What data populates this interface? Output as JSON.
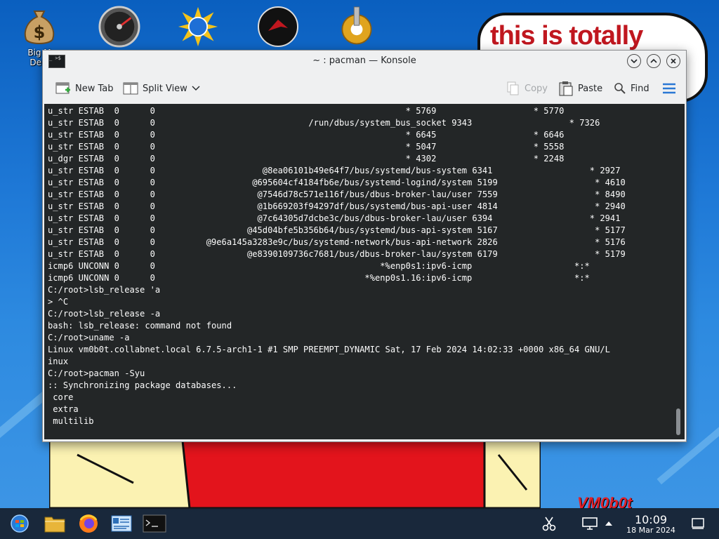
{
  "desktop": {
    "bubble_text": "this is totally",
    "signature": "VM0b0t",
    "icons": [
      {
        "name": "money-bag-icon",
        "label": "Big M"
      },
      {
        "name": "speedometer-icon",
        "label": ""
      },
      {
        "name": "sun-globe-icon",
        "label": ""
      },
      {
        "name": "red-disc-icon",
        "label": ""
      },
      {
        "name": "gear-icon",
        "label": ""
      }
    ],
    "icon0_label_line2": "Dele"
  },
  "window": {
    "title": "~ : pacman — Konsole",
    "icon_glyph": "_ >$",
    "buttons": [
      "minimize",
      "maximize",
      "close"
    ]
  },
  "toolbar": {
    "new_tab": "New Tab",
    "split_view": "Split View",
    "copy": "Copy",
    "paste": "Paste",
    "find": "Find"
  },
  "terminal": {
    "lines": [
      "u_str ESTAB  0      0                                                 * 5769                   * 5770",
      "u_str ESTAB  0      0                              /run/dbus/system_bus_socket 9343                   * 7326",
      "u_str ESTAB  0      0                                                 * 6645                   * 6646",
      "u_str ESTAB  0      0                                                 * 5047                   * 5558",
      "u_dgr ESTAB  0      0                                                 * 4302                   * 2248",
      "u_str ESTAB  0      0                     @8ea06101b49e64f7/bus/systemd/bus-system 6341                   * 2927",
      "u_str ESTAB  0      0                   @695604cf4184fb6e/bus/systemd-logind/system 5199                   * 4610",
      "u_str ESTAB  0      0                    @7546d78c571e116f/bus/dbus-broker-lau/user 7559                   * 8490",
      "u_str ESTAB  0      0                    @1b669203f94297df/bus/systemd/bus-api-user 4814                   * 2940",
      "u_str ESTAB  0      0                    @7c64305d7dcbe3c/bus/dbus-broker-lau/user 6394                   * 2941",
      "u_str ESTAB  0      0                  @45d04bfe5b356b64/bus/systemd/bus-api-system 5167                   * 5177",
      "u_str ESTAB  0      0          @9e6a145a3283e9c/bus/systemd-network/bus-api-network 2826                   * 5176",
      "u_str ESTAB  0      0                  @e8390109736c7681/bus/dbus-broker-lau/system 6179                   * 5179",
      "icmp6 UNCONN 0      0                                            *%enp0s1:ipv6-icmp                    *:*",
      "icmp6 UNCONN 0      0                                         *%enp0s1.16:ipv6-icmp                    *:*",
      "C:/root>lsb_release 'a",
      "> ^C",
      "C:/root>lsb_release -a",
      "bash: lsb_release: command not found",
      "C:/root>uname -a",
      "Linux vm0b0t.collabnet.local 6.7.5-arch1-1 #1 SMP PREEMPT_DYNAMIC Sat, 17 Feb 2024 14:02:33 +0000 x86_64 GNU/L",
      "inux",
      "C:/root>pacman -Syu",
      ":: Synchronizing package databases...",
      " core",
      " extra",
      " multilib"
    ]
  },
  "taskbar": {
    "items": [
      "start-menu",
      "file-manager",
      "firefox",
      "system-settings",
      "konsole"
    ],
    "tray": [
      "scissors-icon",
      "display-icon",
      "tray-expand-icon"
    ],
    "time": "10:09",
    "date": "18 Mar 2024"
  }
}
